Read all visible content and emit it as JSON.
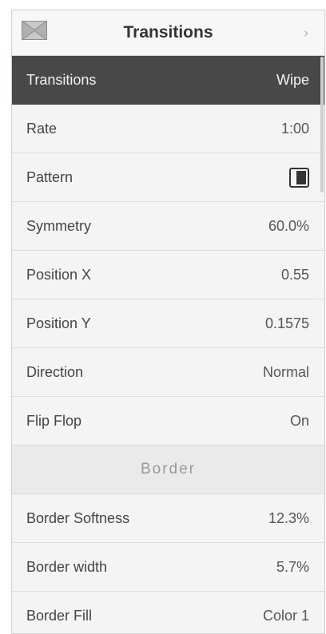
{
  "header": {
    "title": "Transitions",
    "chevron": "›",
    "icon": "transitions-icon"
  },
  "rows": [
    {
      "label": "Transitions",
      "value": "Wipe"
    },
    {
      "label": "Rate",
      "value": "1:00"
    },
    {
      "label": "Pattern",
      "value_icon": "wipe-pattern-icon"
    },
    {
      "label": "Symmetry",
      "value": "60.0%"
    },
    {
      "label": "Position X",
      "value": "0.55"
    },
    {
      "label": "Position Y",
      "value": "0.1575"
    },
    {
      "label": "Direction",
      "value": "Normal"
    },
    {
      "label": "Flip Flop",
      "value": "On"
    }
  ],
  "border_section": {
    "title": "Border",
    "rows": [
      {
        "label": "Border Softness",
        "value": "12.3%"
      },
      {
        "label": "Border width",
        "value": "5.7%"
      },
      {
        "label": "Border Fill",
        "value": "Color 1"
      }
    ]
  },
  "colors": {
    "selected_row_bg": "#484848",
    "row_bg": "#f4f4f4",
    "section_header_bg": "#eaeaea"
  }
}
